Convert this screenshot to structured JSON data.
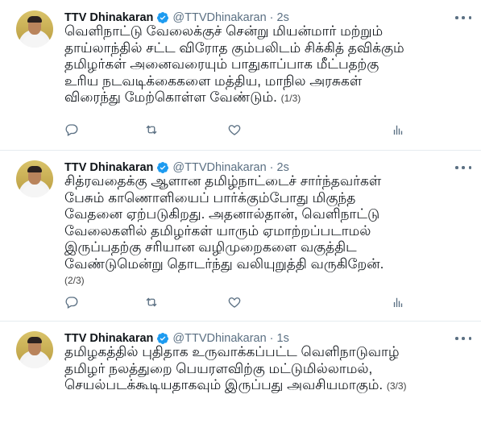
{
  "tweets": [
    {
      "name": "TTV Dhinakaran",
      "handle": "@TTVDhinakaran · 2s",
      "lines": [
        "வெளிநாட்டு வேலைக்குச் சென்று மியன்மார் மற்றும்",
        "தாய்லாந்தில் சட்ட விரோத கும்பலிடம் சிக்கித் தவிக்கும்",
        "தமிழர்கள் அனைவரையும் பாதுகாப்பாக மீட்பதற்கு",
        "உரிய நடவடிக்கைகளை மத்திய, மாநில அரசுகள்",
        "விரைந்து மேற்கொள்ள வேண்டும். "
      ],
      "page_marker": "(1/3)"
    },
    {
      "name": "TTV Dhinakaran",
      "handle": "@TTVDhinakaran · 2s",
      "lines": [
        "சித்ரவதைக்கு ஆளான தமிழ்நாட்டைச் சார்ந்தவர்கள்",
        "பேசும் காணொளியைப் பார்க்கும்போது மிகுந்த",
        "வேதனை ஏற்படுகிறது. அதனால்தான், வெளிநாட்டு",
        "வேலைகளில் தமிழர்கள் யாரும் ஏமாற்றப்படாமல்",
        "இருப்பதற்கு சரியான வழிமுறைகளை வகுத்திட",
        "வேண்டுமென்று தொடர்ந்து வலியுறுத்தி வருகிறேன்."
      ],
      "page_marker": "(2/3)"
    },
    {
      "name": "TTV Dhinakaran",
      "handle": "@TTVDhinakaran · 1s",
      "lines": [
        "தமிழகத்தில் புதிதாக உருவாக்கப்பட்ட வெளிநாடுவாழ்",
        "தமிழர் நலத்துறை பெயரளவிற்கு மட்டுமில்லாமல்,",
        "செயல்படக்கூடியதாகவும் இருப்பது அவசியமாகும். "
      ],
      "page_marker": "(3/3)"
    }
  ],
  "icons": {
    "verified": "verified-badge-icon",
    "more": "more-icon",
    "reply": "reply-icon",
    "retweet": "retweet-icon",
    "like": "like-icon",
    "analytics": "analytics-icon"
  },
  "colors": {
    "text": "#0f1419",
    "secondary": "#5b7083",
    "verified": "#1d9bf0",
    "divider": "#e6ecf0"
  }
}
